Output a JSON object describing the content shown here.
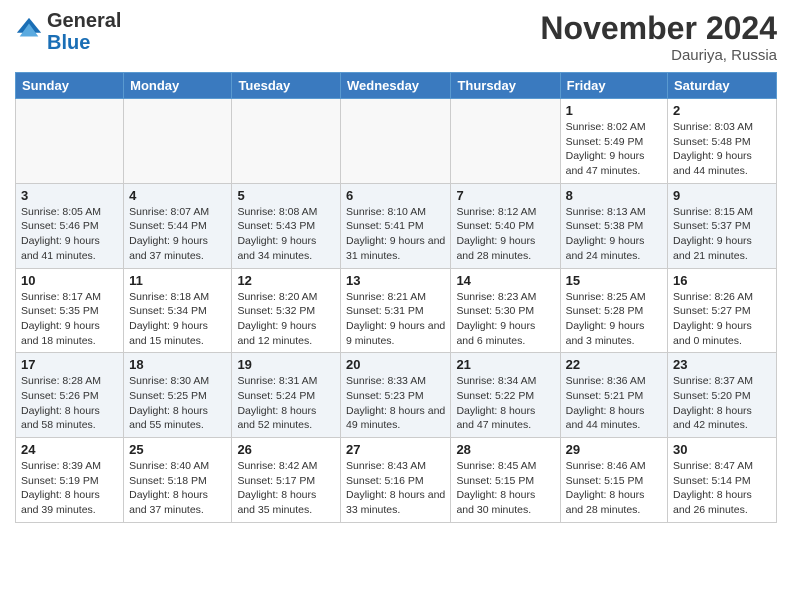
{
  "header": {
    "logo_general": "General",
    "logo_blue": "Blue",
    "month_title": "November 2024",
    "location": "Dauriya, Russia"
  },
  "weekdays": [
    "Sunday",
    "Monday",
    "Tuesday",
    "Wednesday",
    "Thursday",
    "Friday",
    "Saturday"
  ],
  "weeks": [
    [
      {
        "day": "",
        "info": ""
      },
      {
        "day": "",
        "info": ""
      },
      {
        "day": "",
        "info": ""
      },
      {
        "day": "",
        "info": ""
      },
      {
        "day": "",
        "info": ""
      },
      {
        "day": "1",
        "info": "Sunrise: 8:02 AM\nSunset: 5:49 PM\nDaylight: 9 hours and 47 minutes."
      },
      {
        "day": "2",
        "info": "Sunrise: 8:03 AM\nSunset: 5:48 PM\nDaylight: 9 hours and 44 minutes."
      }
    ],
    [
      {
        "day": "3",
        "info": "Sunrise: 8:05 AM\nSunset: 5:46 PM\nDaylight: 9 hours and 41 minutes."
      },
      {
        "day": "4",
        "info": "Sunrise: 8:07 AM\nSunset: 5:44 PM\nDaylight: 9 hours and 37 minutes."
      },
      {
        "day": "5",
        "info": "Sunrise: 8:08 AM\nSunset: 5:43 PM\nDaylight: 9 hours and 34 minutes."
      },
      {
        "day": "6",
        "info": "Sunrise: 8:10 AM\nSunset: 5:41 PM\nDaylight: 9 hours and 31 minutes."
      },
      {
        "day": "7",
        "info": "Sunrise: 8:12 AM\nSunset: 5:40 PM\nDaylight: 9 hours and 28 minutes."
      },
      {
        "day": "8",
        "info": "Sunrise: 8:13 AM\nSunset: 5:38 PM\nDaylight: 9 hours and 24 minutes."
      },
      {
        "day": "9",
        "info": "Sunrise: 8:15 AM\nSunset: 5:37 PM\nDaylight: 9 hours and 21 minutes."
      }
    ],
    [
      {
        "day": "10",
        "info": "Sunrise: 8:17 AM\nSunset: 5:35 PM\nDaylight: 9 hours and 18 minutes."
      },
      {
        "day": "11",
        "info": "Sunrise: 8:18 AM\nSunset: 5:34 PM\nDaylight: 9 hours and 15 minutes."
      },
      {
        "day": "12",
        "info": "Sunrise: 8:20 AM\nSunset: 5:32 PM\nDaylight: 9 hours and 12 minutes."
      },
      {
        "day": "13",
        "info": "Sunrise: 8:21 AM\nSunset: 5:31 PM\nDaylight: 9 hours and 9 minutes."
      },
      {
        "day": "14",
        "info": "Sunrise: 8:23 AM\nSunset: 5:30 PM\nDaylight: 9 hours and 6 minutes."
      },
      {
        "day": "15",
        "info": "Sunrise: 8:25 AM\nSunset: 5:28 PM\nDaylight: 9 hours and 3 minutes."
      },
      {
        "day": "16",
        "info": "Sunrise: 8:26 AM\nSunset: 5:27 PM\nDaylight: 9 hours and 0 minutes."
      }
    ],
    [
      {
        "day": "17",
        "info": "Sunrise: 8:28 AM\nSunset: 5:26 PM\nDaylight: 8 hours and 58 minutes."
      },
      {
        "day": "18",
        "info": "Sunrise: 8:30 AM\nSunset: 5:25 PM\nDaylight: 8 hours and 55 minutes."
      },
      {
        "day": "19",
        "info": "Sunrise: 8:31 AM\nSunset: 5:24 PM\nDaylight: 8 hours and 52 minutes."
      },
      {
        "day": "20",
        "info": "Sunrise: 8:33 AM\nSunset: 5:23 PM\nDaylight: 8 hours and 49 minutes."
      },
      {
        "day": "21",
        "info": "Sunrise: 8:34 AM\nSunset: 5:22 PM\nDaylight: 8 hours and 47 minutes."
      },
      {
        "day": "22",
        "info": "Sunrise: 8:36 AM\nSunset: 5:21 PM\nDaylight: 8 hours and 44 minutes."
      },
      {
        "day": "23",
        "info": "Sunrise: 8:37 AM\nSunset: 5:20 PM\nDaylight: 8 hours and 42 minutes."
      }
    ],
    [
      {
        "day": "24",
        "info": "Sunrise: 8:39 AM\nSunset: 5:19 PM\nDaylight: 8 hours and 39 minutes."
      },
      {
        "day": "25",
        "info": "Sunrise: 8:40 AM\nSunset: 5:18 PM\nDaylight: 8 hours and 37 minutes."
      },
      {
        "day": "26",
        "info": "Sunrise: 8:42 AM\nSunset: 5:17 PM\nDaylight: 8 hours and 35 minutes."
      },
      {
        "day": "27",
        "info": "Sunrise: 8:43 AM\nSunset: 5:16 PM\nDaylight: 8 hours and 33 minutes."
      },
      {
        "day": "28",
        "info": "Sunrise: 8:45 AM\nSunset: 5:15 PM\nDaylight: 8 hours and 30 minutes."
      },
      {
        "day": "29",
        "info": "Sunrise: 8:46 AM\nSunset: 5:15 PM\nDaylight: 8 hours and 28 minutes."
      },
      {
        "day": "30",
        "info": "Sunrise: 8:47 AM\nSunset: 5:14 PM\nDaylight: 8 hours and 26 minutes."
      }
    ]
  ]
}
